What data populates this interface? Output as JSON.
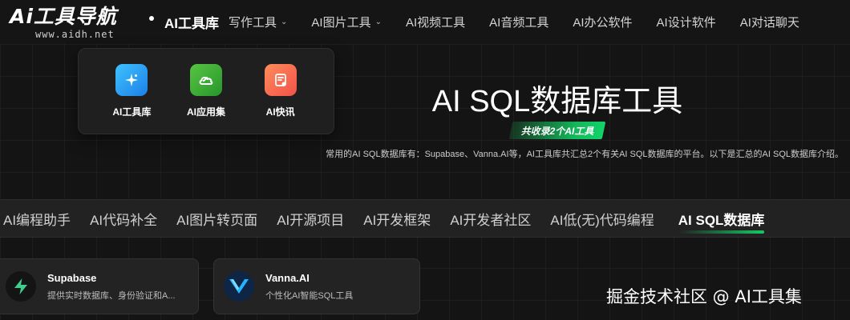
{
  "header": {
    "logo_text": "Ai工具导航",
    "logo_url": "www.aidh.net",
    "nav": [
      {
        "label": "AI工具库",
        "active": true
      },
      {
        "label": "写作工具",
        "chevron": true
      },
      {
        "label": "AI图片工具",
        "chevron": true
      },
      {
        "label": "AI视频工具"
      },
      {
        "label": "AI音频工具"
      },
      {
        "label": "AI办公软件"
      },
      {
        "label": "AI设计软件"
      },
      {
        "label": "AI对话聊天"
      }
    ]
  },
  "dropdown": {
    "items": [
      {
        "label": "AI工具库",
        "icon": "sparkle-icon",
        "color": "#2f9ff5"
      },
      {
        "label": "AI应用集",
        "icon": "cloud-icon",
        "color": "#3fae35"
      },
      {
        "label": "AI快讯",
        "icon": "news-icon",
        "color": "#f46b52"
      }
    ]
  },
  "hero": {
    "title": "AI SQL数据库工具",
    "badge": "共收录2个AI工具",
    "description": "常用的AI SQL数据库有：Supabase、Vanna.AI等，AI工具库共汇总2个有关AI SQL数据库的平台。以下是汇总的AI SQL数据库介绍。"
  },
  "tabs": [
    {
      "label": "AI编程助手"
    },
    {
      "label": "AI代码补全"
    },
    {
      "label": "AI图片转页面"
    },
    {
      "label": "AI开源项目"
    },
    {
      "label": "AI开发框架"
    },
    {
      "label": "AI开发者社区"
    },
    {
      "label": "AI低(无)代码编程"
    },
    {
      "label": "AI SQL数据库",
      "active": true
    }
  ],
  "cards": [
    {
      "title": "Supabase",
      "desc": "提供实时数据库、身份验证和A...",
      "icon": "supabase-bolt-icon"
    },
    {
      "title": "Vanna.AI",
      "desc": "个性化AI智能SQL工具",
      "icon": "vanna-v-icon"
    }
  ],
  "watermark": "掘金技术社区 @ AI工具集",
  "colors": {
    "accent": "#17c964",
    "background": "#121212"
  }
}
